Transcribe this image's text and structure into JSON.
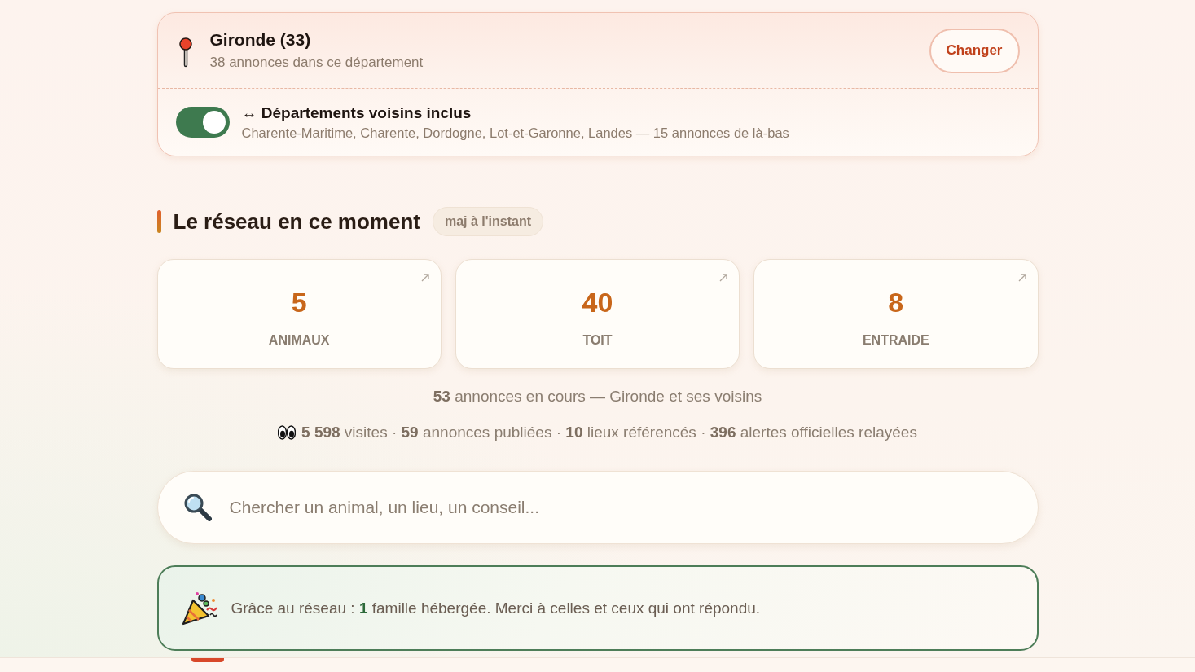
{
  "location": {
    "title": "Gironde (33)",
    "subtitle": "38 annonces dans ce département",
    "change_button": "Changer"
  },
  "neighbors": {
    "on": true,
    "title": "↔ Départements voisins inclus",
    "details": "Charente-Maritime, Charente, Dordogne, Lot-et-Garonne, Landes — 15 annonces de là-bas"
  },
  "section": {
    "title": "Le réseau en ce moment",
    "badge": "maj à l'instant"
  },
  "stats": [
    {
      "value": "5",
      "label": "ANIMAUX"
    },
    {
      "value": "40",
      "label": "TOIT"
    },
    {
      "value": "8",
      "label": "ENTRAIDE"
    }
  ],
  "summary": "**53** annonces en cours — Gironde et ses voisins",
  "totals": "**5 598** visites · **59** annonces publiées · **10** lieux référencés · **396** alertes officielles relayées",
  "search": {
    "placeholder": "Chercher un animal, un lieu, un conseil..."
  },
  "thanks": "Grâce au réseau : **1** famille hébergée. Merci à celles et ceux qui ont répondu."
}
